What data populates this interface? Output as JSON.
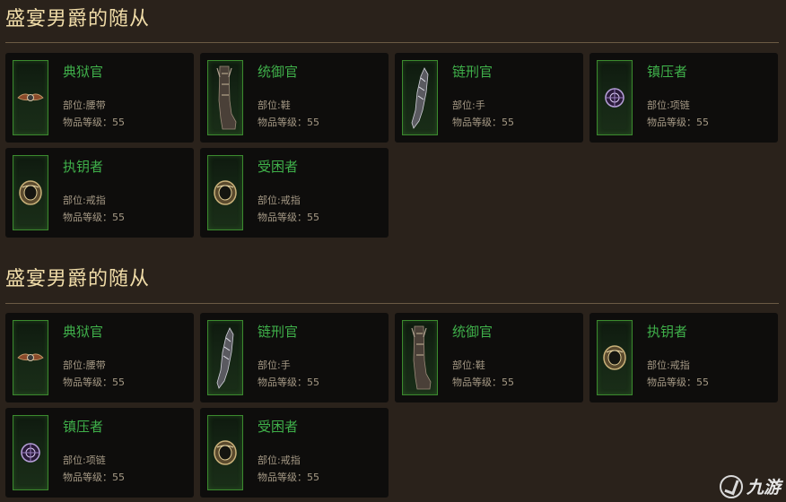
{
  "sections": [
    {
      "title": "盛宴男爵的随从",
      "items": [
        {
          "name": "典狱官",
          "slot": "部位:腰带",
          "level": "物品等级：55",
          "icon": "belt"
        },
        {
          "name": "统御官",
          "slot": "部位:鞋",
          "level": "物品等级：55",
          "icon": "boots"
        },
        {
          "name": "链刑官",
          "slot": "部位:手",
          "level": "物品等级：55",
          "icon": "gloves"
        },
        {
          "name": "镇压者",
          "slot": "部位:项链",
          "level": "物品等级：55",
          "icon": "amulet"
        },
        {
          "name": "执钥者",
          "slot": "部位:戒指",
          "level": "物品等级：55",
          "icon": "ring"
        },
        {
          "name": "受困者",
          "slot": "部位:戒指",
          "level": "物品等级：55",
          "icon": "ring"
        }
      ]
    },
    {
      "title": "盛宴男爵的随从",
      "items": [
        {
          "name": "典狱官",
          "slot": "部位:腰带",
          "level": "物品等级：55",
          "icon": "belt"
        },
        {
          "name": "链刑官",
          "slot": "部位:手",
          "level": "物品等级：55",
          "icon": "gloves"
        },
        {
          "name": "统御官",
          "slot": "部位:鞋",
          "level": "物品等级：55",
          "icon": "boots"
        },
        {
          "name": "执钥者",
          "slot": "部位:戒指",
          "level": "物品等级：55",
          "icon": "ring"
        },
        {
          "name": "镇压者",
          "slot": "部位:项链",
          "level": "物品等级：55",
          "icon": "amulet"
        },
        {
          "name": "受困者",
          "slot": "部位:戒指",
          "level": "物品等级：55",
          "icon": "ring"
        }
      ]
    }
  ],
  "watermark": {
    "text": "九游"
  },
  "colors": {
    "item_name": "#3fb04a",
    "title": "#f0dca8",
    "frame_border": "#3b8a2e"
  }
}
